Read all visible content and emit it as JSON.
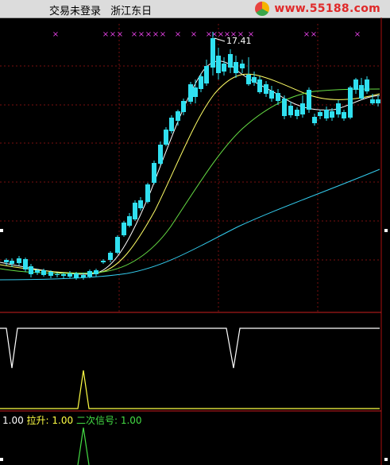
{
  "window": {
    "title_left": "交易未登录",
    "title_stock": "浙江东日",
    "logo_text": "www.55188.com",
    "logo_icon": "circle-logo-icon"
  },
  "main_chart": {
    "high_label": "17.41",
    "colors": {
      "up": "#e8333a",
      "down": "#30e0f0",
      "ma5": "#ffffff",
      "ma10": "#ffff66",
      "ma20": "#66dd44",
      "ma60": "#33ccee",
      "marker": "#e040e0"
    },
    "marker_glyph": "×"
  },
  "indicator_row": {
    "v1_label": "1.00",
    "lashen_label": "拉升:",
    "lashen_value": "1.00",
    "signal_label": "二次信号:",
    "signal_value": "1.00"
  }
}
